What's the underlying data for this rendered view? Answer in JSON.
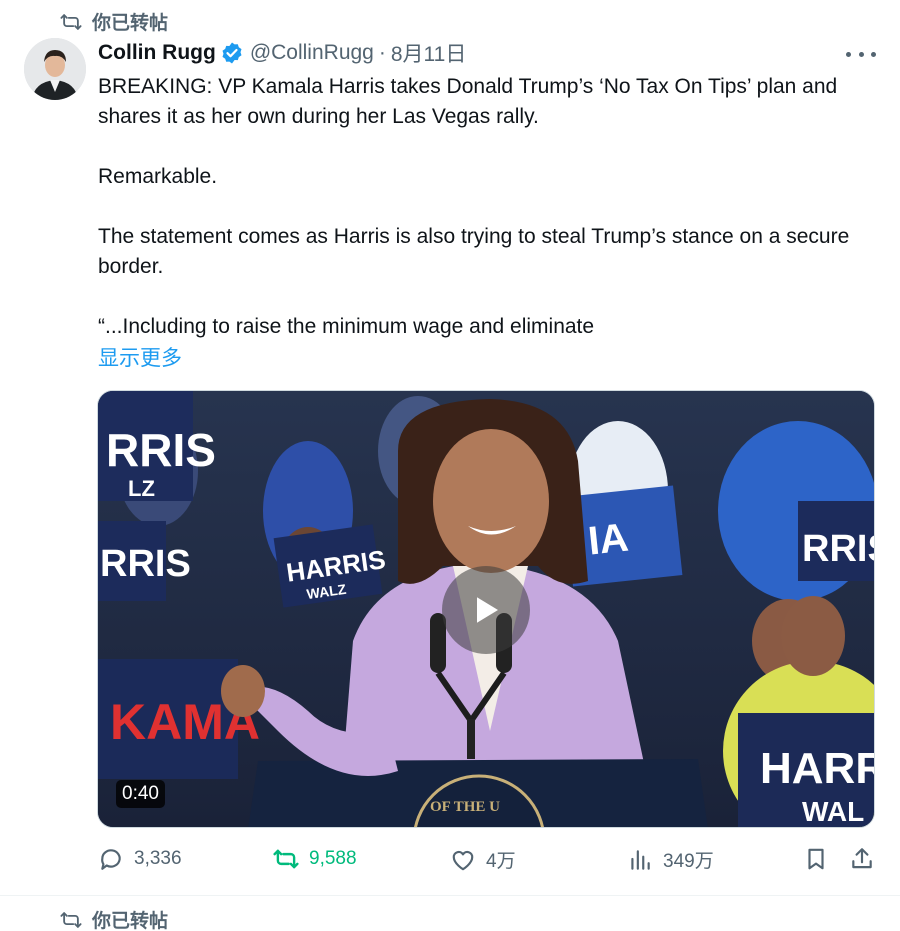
{
  "social_context": {
    "top": "你已转帖",
    "bottom": "你已转帖"
  },
  "author": {
    "display_name": "Collin Rugg",
    "handle": "@CollinRugg",
    "separator": "·",
    "date": "8月11日"
  },
  "post": {
    "paragraphs": [
      "BREAKING: VP Kamala Harris takes Donald Trump’s ‘No Tax On Tips’ plan and shares it as her own during her Las Vegas rally.",
      "Remarkable.",
      "The statement comes as Harris is also trying to steal Trump’s stance on a secure border.",
      "“...Including to raise the minimum wage and eliminate"
    ],
    "show_more": "显示更多"
  },
  "media": {
    "duration": "0:40",
    "signs": [
      "RRIS",
      "LZ",
      "HARRIS",
      "WALZ",
      "RRIS",
      "IA",
      "RRIS",
      "KAMA",
      "HARR",
      "WAL",
      "OF THE U"
    ]
  },
  "actions": {
    "replies": "3,336",
    "reposts": "9,588",
    "likes": "4万",
    "views": "349万"
  },
  "colors": {
    "accent": "#1d9bf0",
    "repost_active": "#00ba7c",
    "secondary_text": "#536471"
  },
  "icons": [
    "repost-icon",
    "verified-badge-icon",
    "more-icon",
    "play-icon",
    "reply-icon",
    "like-icon",
    "views-icon",
    "bookmark-icon",
    "share-icon"
  ]
}
